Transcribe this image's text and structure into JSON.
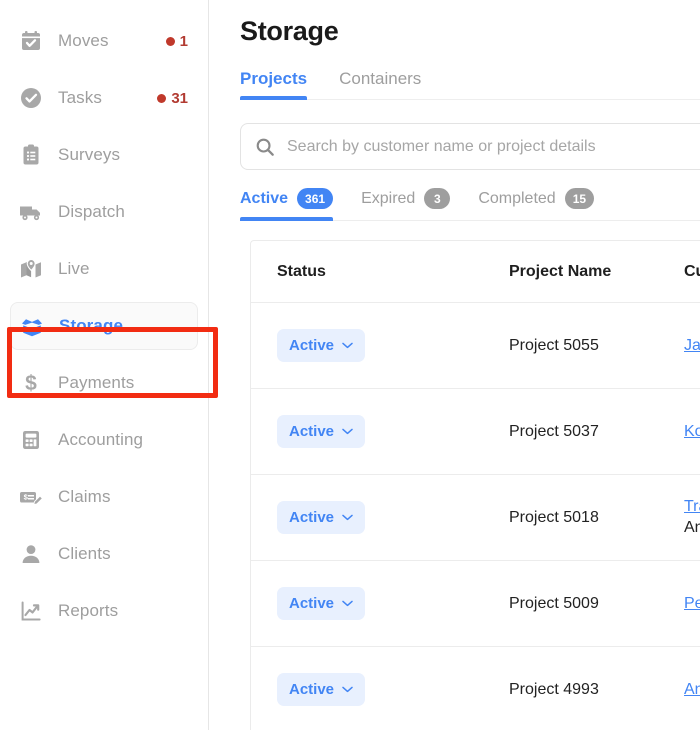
{
  "sidebar": {
    "items": [
      {
        "label": "Moves",
        "icon": "calendar-check-icon",
        "badge": "1",
        "active": false
      },
      {
        "label": "Tasks",
        "icon": "check-circle-icon",
        "badge": "31",
        "active": false
      },
      {
        "label": "Surveys",
        "icon": "clipboard-list-icon",
        "badge": "",
        "active": false
      },
      {
        "label": "Dispatch",
        "icon": "truck-icon",
        "badge": "",
        "active": false
      },
      {
        "label": "Live",
        "icon": "map-pin-icon",
        "badge": "",
        "active": false
      },
      {
        "label": "Storage",
        "icon": "open-box-icon",
        "badge": "",
        "active": true
      },
      {
        "label": "Payments",
        "icon": "dollar-sign-icon",
        "badge": "",
        "active": false
      },
      {
        "label": "Accounting",
        "icon": "calculator-icon",
        "badge": "",
        "active": false
      },
      {
        "label": "Claims",
        "icon": "check-edit-icon",
        "badge": "",
        "active": false
      },
      {
        "label": "Clients",
        "icon": "person-icon",
        "badge": "",
        "active": false
      },
      {
        "label": "Reports",
        "icon": "chart-line-icon",
        "badge": "",
        "active": false
      }
    ]
  },
  "header": {
    "title": "Storage",
    "tabs": [
      {
        "label": "Projects",
        "active": true
      },
      {
        "label": "Containers",
        "active": false
      }
    ]
  },
  "search": {
    "placeholder": "Search by customer name or project details",
    "value": "",
    "icon": "search-icon"
  },
  "filters": [
    {
      "label": "Active",
      "count": "361",
      "active": true
    },
    {
      "label": "Expired",
      "count": "3",
      "active": false
    },
    {
      "label": "Completed",
      "count": "15",
      "active": false
    }
  ],
  "table": {
    "columns": [
      {
        "key": "status",
        "label": "Status"
      },
      {
        "key": "name",
        "label": "Project Name"
      },
      {
        "key": "cust",
        "label": "Cust"
      }
    ],
    "rows": [
      {
        "status": "Active",
        "name": "Project 5055",
        "customer": "Jarr",
        "customer_sub": ""
      },
      {
        "status": "Active",
        "name": "Project 5037",
        "customer": "Koc",
        "customer_sub": ""
      },
      {
        "status": "Active",
        "name": "Project 5018",
        "customer": "Trai",
        "customer_sub": "Anc"
      },
      {
        "status": "Active",
        "name": "Project 5009",
        "customer": "Pete",
        "customer_sub": ""
      },
      {
        "status": "Active",
        "name": "Project 4993",
        "customer": "Anc",
        "customer_sub": ""
      }
    ]
  },
  "colors": {
    "accent_blue": "#4285f4",
    "pill_bg": "#e8f0fe",
    "badge_gray": "#9e9e9e",
    "nav_gray": "#9e9e9e",
    "notification_red": "#c0392b",
    "annotation_red": "#f22c12"
  },
  "annotation": {
    "target": "Storage",
    "shape": "rectangle"
  }
}
